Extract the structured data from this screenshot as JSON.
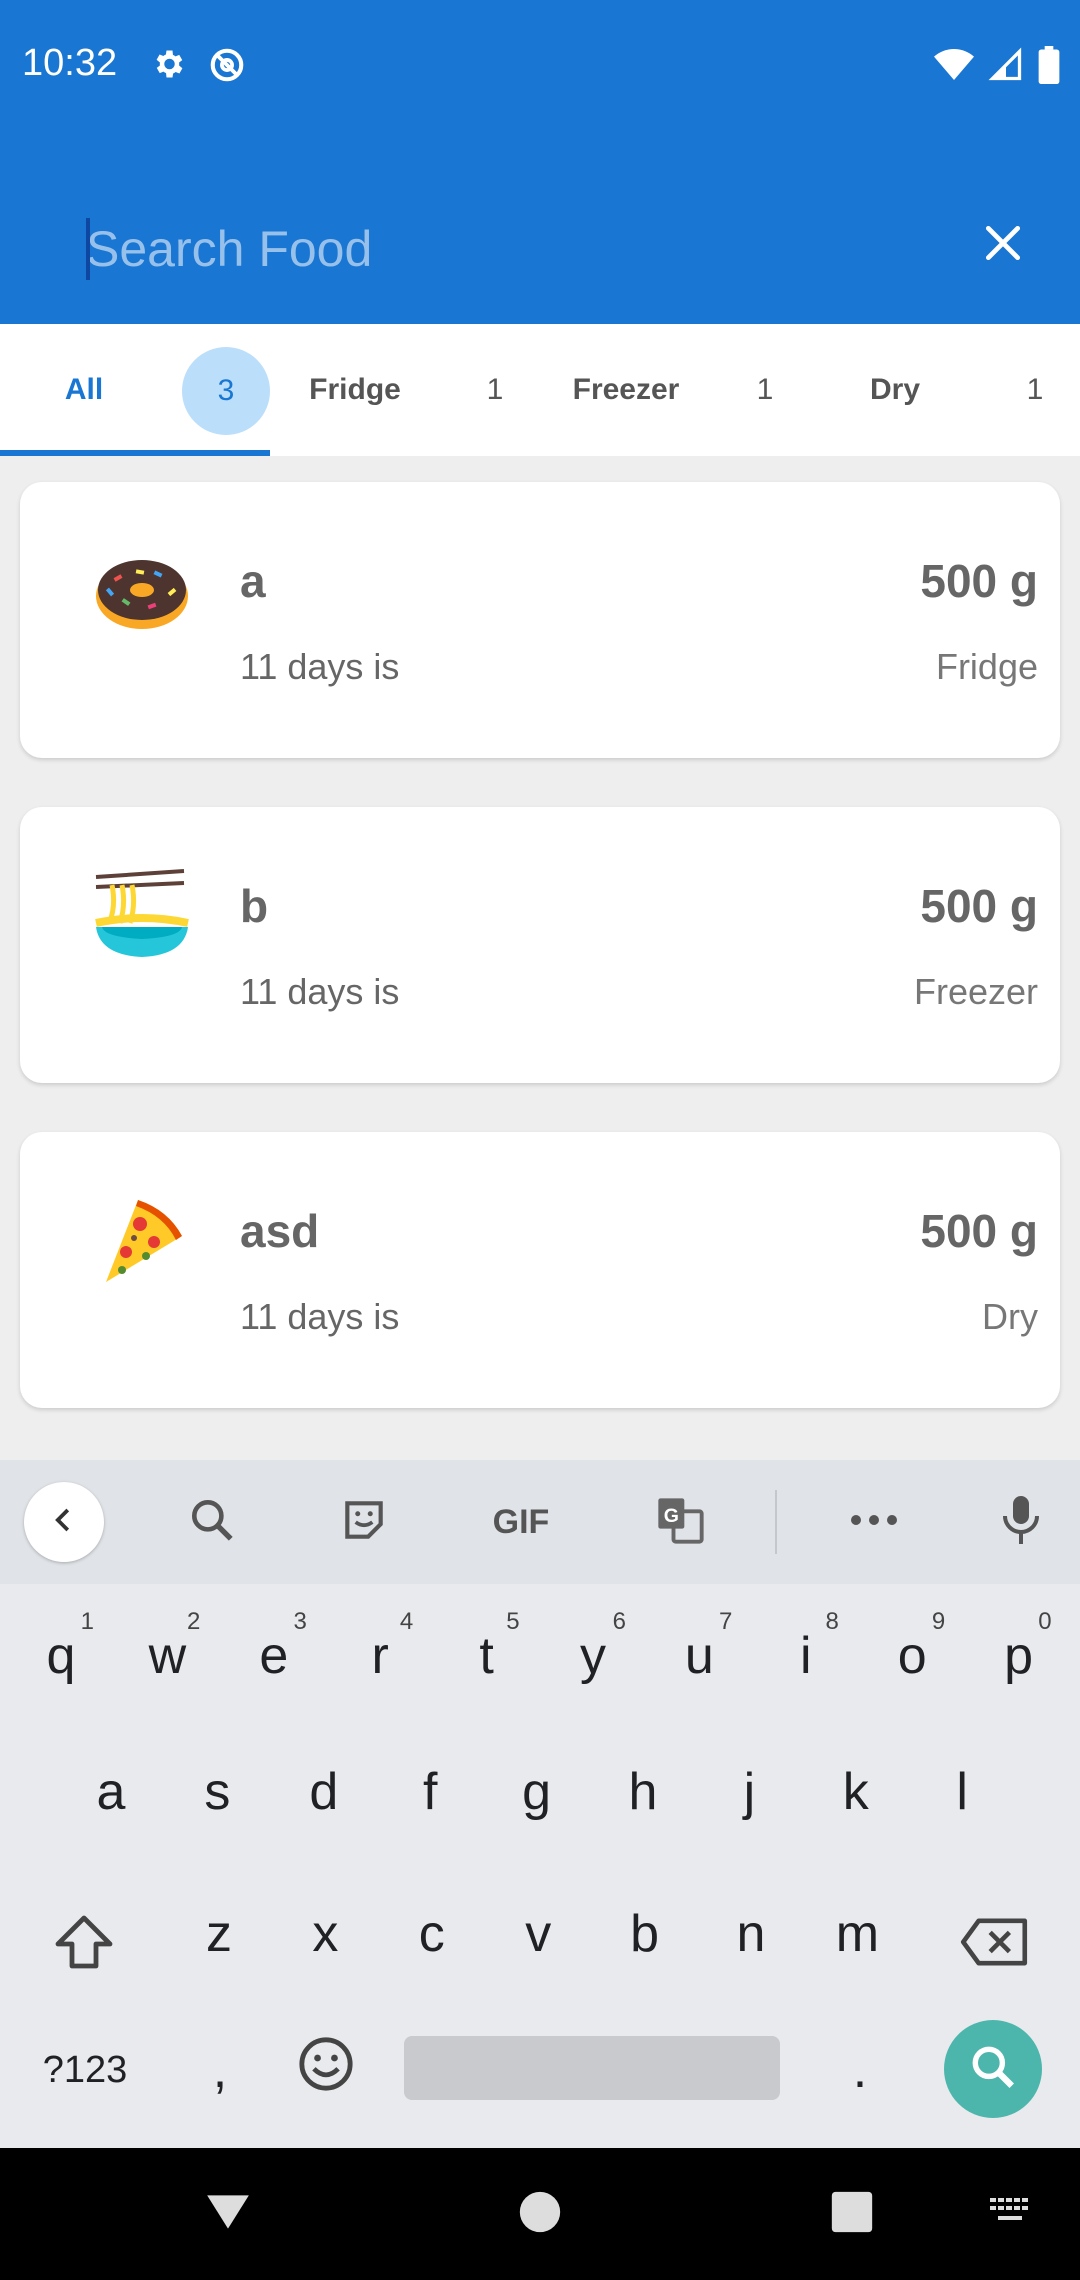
{
  "status_bar": {
    "time": "10:32",
    "left_icons": [
      "gear-icon",
      "do-not-disturb-icon"
    ],
    "right_icons": [
      "wifi-icon",
      "signal-icon",
      "battery-icon"
    ]
  },
  "search": {
    "placeholder": "Search Food",
    "value": ""
  },
  "tabs": [
    {
      "label": "All",
      "count": "3",
      "selected": true
    },
    {
      "label": "Fridge",
      "count": "1",
      "selected": false
    },
    {
      "label": "Freezer",
      "count": "1",
      "selected": false
    },
    {
      "label": "Dry",
      "count": "1",
      "selected": false
    }
  ],
  "items": [
    {
      "icon": "donut-icon",
      "name": "a",
      "quantity": "500 g",
      "days": "11 days is",
      "location": "Fridge"
    },
    {
      "icon": "noodles-icon",
      "name": "b",
      "quantity": "500 g",
      "days": "11 days is",
      "location": "Freezer"
    },
    {
      "icon": "pizza-icon",
      "name": "asd",
      "quantity": "500 g",
      "days": "11 days is",
      "location": "Dry"
    }
  ],
  "keyboard": {
    "toolbar": {
      "gif_label": "GIF",
      "icons": [
        "back-icon",
        "search-icon",
        "sticker-icon",
        "gif-icon",
        "translate-icon",
        "more-icon",
        "mic-icon"
      ]
    },
    "row1": [
      "q",
      "w",
      "e",
      "r",
      "t",
      "y",
      "u",
      "i",
      "o",
      "p"
    ],
    "row1_hints": [
      "1",
      "2",
      "3",
      "4",
      "5",
      "6",
      "7",
      "8",
      "9",
      "0"
    ],
    "row2": [
      "a",
      "s",
      "d",
      "f",
      "g",
      "h",
      "j",
      "k",
      "l"
    ],
    "row3": [
      "z",
      "x",
      "c",
      "v",
      "b",
      "n",
      "m"
    ],
    "symbols_label": "?123",
    "comma": ",",
    "period": "."
  },
  "colors": {
    "primary": "#1976d2",
    "tab_bubble": "#bbdefb",
    "search_fab": "#4db6ac"
  }
}
